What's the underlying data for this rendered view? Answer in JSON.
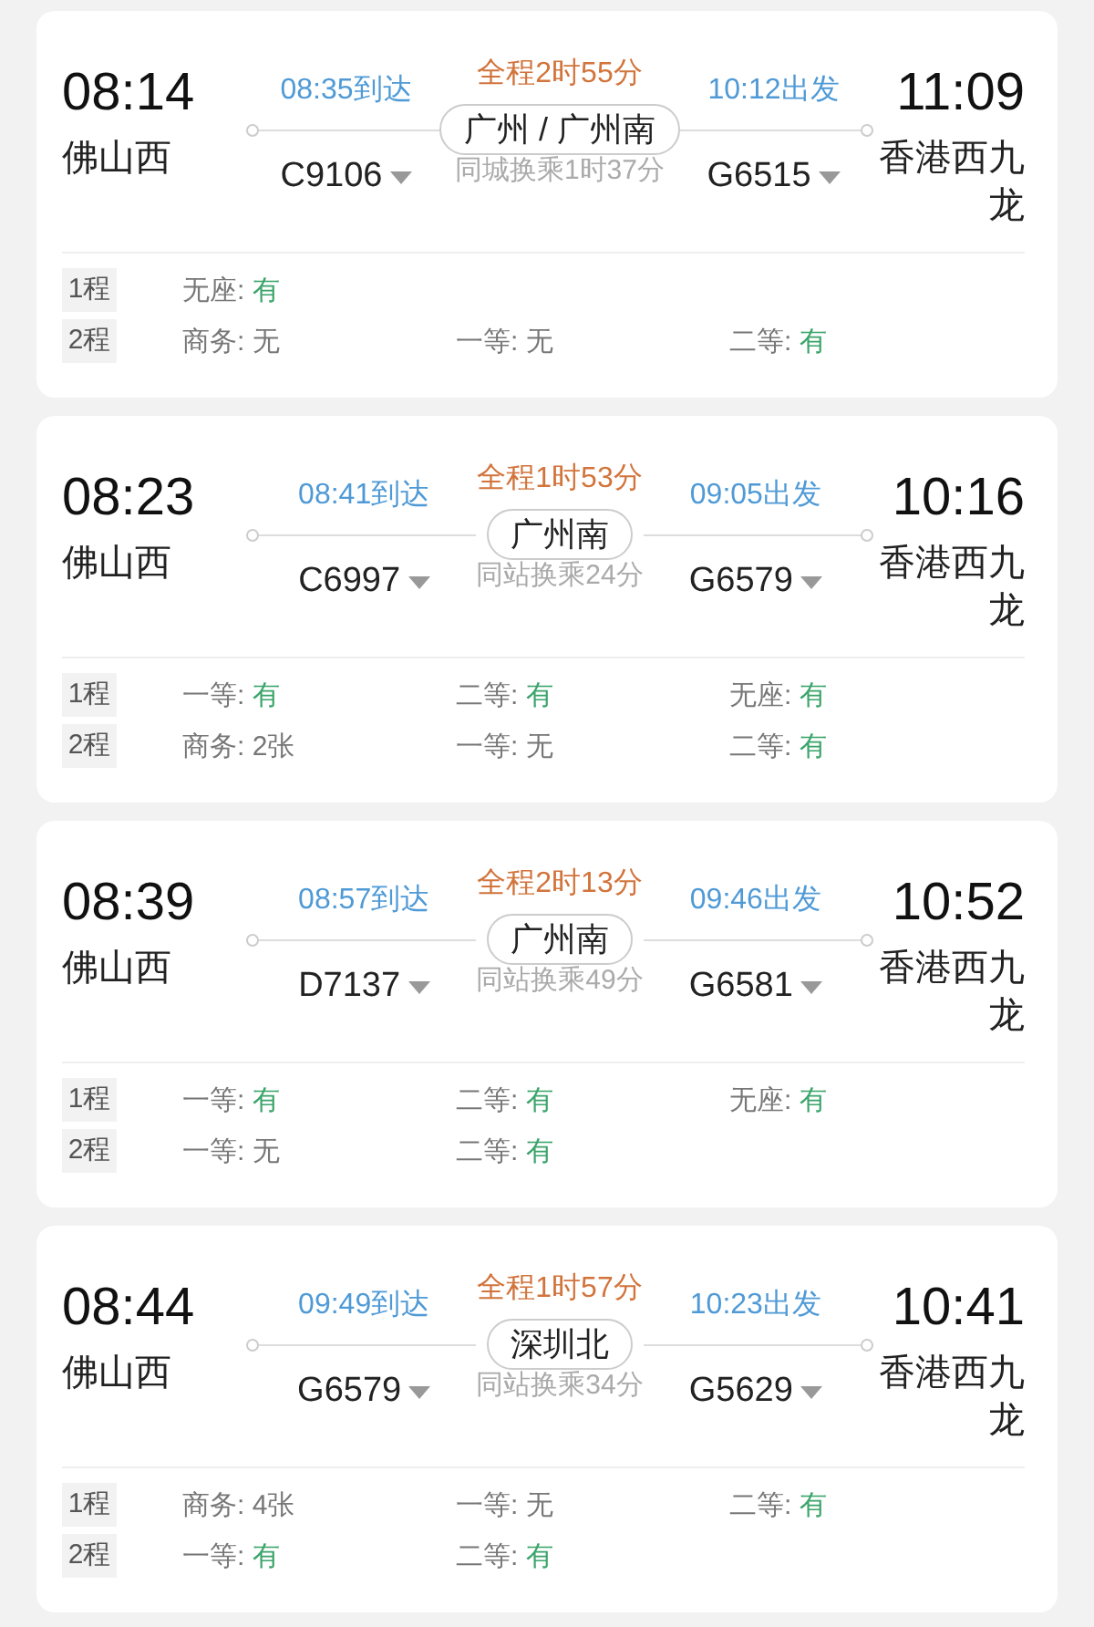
{
  "trips": [
    {
      "depart_time": "08:14",
      "depart_station": "佛山西",
      "leg1_arrival": "08:35到达",
      "leg1_train": "C9106",
      "total": "全程2时55分",
      "transfer_station": "广州 / 广州南",
      "transfer_note": "同城换乘1时37分",
      "leg2_departure": "10:12出发",
      "leg2_train": "G6515",
      "arrive_time": "11:09",
      "arrive_station": "香港西九龙",
      "seats": [
        {
          "leg": "1程",
          "classes": [
            {
              "name": "无座:",
              "value": "有",
              "available": true
            }
          ]
        },
        {
          "leg": "2程",
          "classes": [
            {
              "name": "商务:",
              "value": "无",
              "available": false
            },
            {
              "name": "一等:",
              "value": "无",
              "available": false
            },
            {
              "name": "二等:",
              "value": "有",
              "available": true
            }
          ]
        }
      ]
    },
    {
      "depart_time": "08:23",
      "depart_station": "佛山西",
      "leg1_arrival": "08:41到达",
      "leg1_train": "C6997",
      "total": "全程1时53分",
      "transfer_station": "广州南",
      "transfer_note": "同站换乘24分",
      "leg2_departure": "09:05出发",
      "leg2_train": "G6579",
      "arrive_time": "10:16",
      "arrive_station": "香港西九龙",
      "seats": [
        {
          "leg": "1程",
          "classes": [
            {
              "name": "一等:",
              "value": "有",
              "available": true
            },
            {
              "name": "二等:",
              "value": "有",
              "available": true
            },
            {
              "name": "无座:",
              "value": "有",
              "available": true
            }
          ]
        },
        {
          "leg": "2程",
          "classes": [
            {
              "name": "商务:",
              "value": "2张",
              "available": false
            },
            {
              "name": "一等:",
              "value": "无",
              "available": false
            },
            {
              "name": "二等:",
              "value": "有",
              "available": true
            }
          ]
        }
      ]
    },
    {
      "depart_time": "08:39",
      "depart_station": "佛山西",
      "leg1_arrival": "08:57到达",
      "leg1_train": "D7137",
      "total": "全程2时13分",
      "transfer_station": "广州南",
      "transfer_note": "同站换乘49分",
      "leg2_departure": "09:46出发",
      "leg2_train": "G6581",
      "arrive_time": "10:52",
      "arrive_station": "香港西九龙",
      "seats": [
        {
          "leg": "1程",
          "classes": [
            {
              "name": "一等:",
              "value": "有",
              "available": true
            },
            {
              "name": "二等:",
              "value": "有",
              "available": true
            },
            {
              "name": "无座:",
              "value": "有",
              "available": true
            }
          ]
        },
        {
          "leg": "2程",
          "classes": [
            {
              "name": "一等:",
              "value": "无",
              "available": false
            },
            {
              "name": "二等:",
              "value": "有",
              "available": true
            }
          ]
        }
      ]
    },
    {
      "depart_time": "08:44",
      "depart_station": "佛山西",
      "leg1_arrival": "09:49到达",
      "leg1_train": "G6579",
      "total": "全程1时57分",
      "transfer_station": "深圳北",
      "transfer_note": "同站换乘34分",
      "leg2_departure": "10:23出发",
      "leg2_train": "G5629",
      "arrive_time": "10:41",
      "arrive_station": "香港西九龙",
      "seats": [
        {
          "leg": "1程",
          "classes": [
            {
              "name": "商务:",
              "value": "4张",
              "available": false
            },
            {
              "name": "一等:",
              "value": "无",
              "available": false
            },
            {
              "name": "二等:",
              "value": "有",
              "available": true
            }
          ]
        },
        {
          "leg": "2程",
          "classes": [
            {
              "name": "一等:",
              "value": "有",
              "available": true
            },
            {
              "name": "二等:",
              "value": "有",
              "available": true
            }
          ]
        }
      ]
    }
  ]
}
